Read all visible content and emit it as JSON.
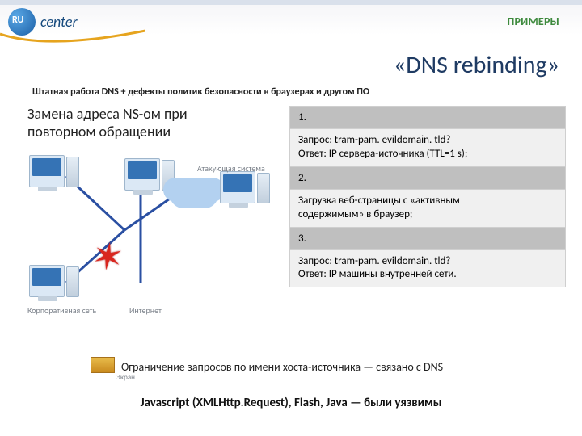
{
  "logo_text": "center",
  "eyebrow": "ПРИМЕРЫ",
  "title": "«DNS rebinding»",
  "subtitle": "Штатная работа DNS + дефекты политик безопасности в браузерах и другом ПО",
  "left_heading_l1": "Замена адреса NS-ом при",
  "left_heading_l2": "повторном обращении",
  "labels": {
    "corp_net": "Корпоративная сеть",
    "internet": "Интернет",
    "attacker": "Атакующая система",
    "screen": "Экран"
  },
  "steps": [
    {
      "num": "1.",
      "body_l1": "Запрос: tram-pam. evildomain. tld?",
      "body_l2": "Ответ: IP сервера-источника (TTL=1 s);"
    },
    {
      "num": "2.",
      "body_l1": "Загрузка веб-страницы с «активным",
      "body_l2": "содержимым» в браузер;"
    },
    {
      "num": "3.",
      "body_l1": "Запрос: tram-pam. evildomain. tld?",
      "body_l2": "Ответ: IP машины внутренней сети."
    }
  ],
  "footer1": "Ограничение запросов по имени хоста-источника — связано с DNS",
  "footer2": "Javascript (XMLHttp.Request), Flash, Java — были уязвимы"
}
